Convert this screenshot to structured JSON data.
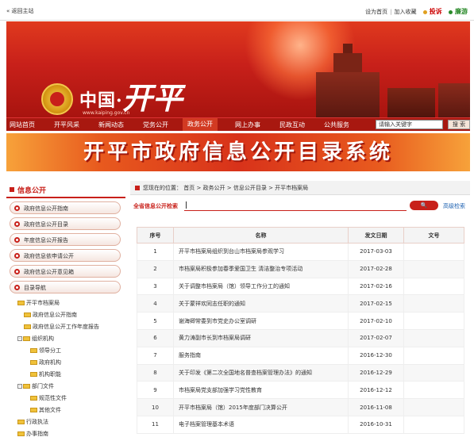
{
  "topbar": {
    "back": "« 返回主站",
    "set_home": "设为首页",
    "sep": "|",
    "favorite": "加入收藏",
    "complaint": "投诉",
    "hotline": "廉游"
  },
  "banner": {
    "logo_cn": "中国·",
    "logo_city": "开平",
    "url": "www.kaiping.gov.cn"
  },
  "nav": {
    "items": [
      "网站首页",
      "开平风采",
      "新闻动态",
      "党务公开",
      "政务公开",
      "网上办事",
      "民政互动",
      "公共服务"
    ],
    "search_placeholder": "请输入关键字",
    "search_button": "搜 索"
  },
  "title_banner": "开平市政府信息公开目录系统",
  "sidebar": {
    "title": "信息公开",
    "menu": [
      "政府信息公开指南",
      "政府信息公开目录",
      "年度信息公开报告",
      "政府信息依申请公开",
      "政府信息公开意见箱",
      "目录导航"
    ],
    "tree": [
      {
        "label": "开平市档案局",
        "level": 0,
        "expand": false
      },
      {
        "label": "政府信息公开指南",
        "level": 1,
        "expand": false
      },
      {
        "label": "政府信息公开工作年度报告",
        "level": 1,
        "expand": false
      },
      {
        "label": "组织机构",
        "level": 1,
        "expand": true
      },
      {
        "label": "领导分工",
        "level": 2,
        "expand": false
      },
      {
        "label": "政府机构",
        "level": 2,
        "expand": false
      },
      {
        "label": "机构职能",
        "level": 2,
        "expand": false
      },
      {
        "label": "部门文件",
        "level": 1,
        "expand": true
      },
      {
        "label": "规范性文件",
        "level": 2,
        "expand": false
      },
      {
        "label": "其他文件",
        "level": 2,
        "expand": false
      },
      {
        "label": "行政执法",
        "level": 1,
        "expand": false
      },
      {
        "label": "办事指南",
        "level": 1,
        "expand": false
      }
    ]
  },
  "main": {
    "breadcrumb": "您现在的位置： 首页 > 政务公开 > 信息公开目录 > 开平市档案局",
    "search_label": "全省信息公开检索",
    "search_button": "🔍",
    "advanced": "高级检索",
    "table": {
      "headers": [
        "序号",
        "名称",
        "发文日期",
        "文号"
      ],
      "rows": [
        [
          "1",
          "开平市档案局组织到台山市档案局参观学习",
          "2017-03-03",
          ""
        ],
        [
          "2",
          "市档案局积极参加春季爱国卫生 清洁整治专项活动",
          "2017-02-28",
          ""
        ],
        [
          "3",
          "关于调整市档案局（馆）领导工作分工的通知",
          "2017-02-16",
          ""
        ],
        [
          "4",
          "关于蒙祥欢同志任职的通知",
          "2017-02-15",
          ""
        ],
        [
          "5",
          "谢海卿常委到市党史办公室调研",
          "2017-02-10",
          ""
        ],
        [
          "6",
          "黄力涛副市长到市档案局调研",
          "2017-02-07",
          ""
        ],
        [
          "7",
          "服务指南",
          "2016-12-30",
          ""
        ],
        [
          "8",
          "关于印发《第二次全国地名普查档案管理办法》的通知",
          "2016-12-29",
          ""
        ],
        [
          "9",
          "市档案局党支部加强学习党性教育",
          "2016-12-12",
          ""
        ],
        [
          "10",
          "开平市档案局（馆）2015年度部门决算公开",
          "2016-11-08",
          ""
        ],
        [
          "11",
          "电子档案管理基本术语",
          "2016-10-31",
          ""
        ]
      ]
    }
  },
  "colors": {
    "primary": "#c8201a",
    "nav": "#a81810",
    "link": "#1a5fb0"
  }
}
